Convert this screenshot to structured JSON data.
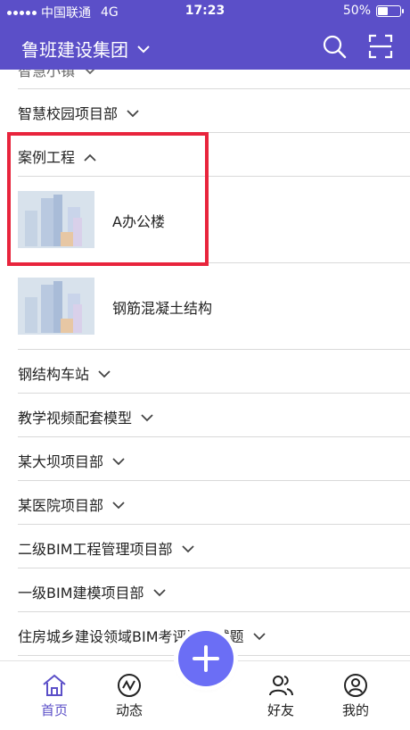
{
  "status_bar": {
    "carrier": "中国联通",
    "network": "4G",
    "time": "17:23",
    "battery": "50%",
    "battery_level": 0.5
  },
  "header": {
    "title": "鲁班建设集团"
  },
  "list": {
    "cut_off_label": "智慧小镇",
    "groups_top": [
      {
        "label": "智慧校园项目部",
        "expanded": false
      },
      {
        "label": "案例工程",
        "expanded": true
      }
    ],
    "items": [
      {
        "label": "A办公楼",
        "thumb": "building-thumbnail"
      },
      {
        "label": "钢筋混凝土结构",
        "thumb": "building-thumbnail"
      }
    ],
    "groups_bottom": [
      {
        "label": "钢结构车站"
      },
      {
        "label": "教学视频配套模型"
      },
      {
        "label": "某大坝项目部"
      },
      {
        "label": "某医院项目部"
      },
      {
        "label": "二级BIM工程管理项目部"
      },
      {
        "label": "一级BIM建模项目部"
      },
      {
        "label": "住房城乡建设领域BIM考评过往试题"
      }
    ]
  },
  "tabbar": {
    "tabs": [
      {
        "label": "首页",
        "icon": "home-icon",
        "active": true
      },
      {
        "label": "动态",
        "icon": "activity-icon",
        "active": false
      },
      {
        "label": "好友",
        "icon": "friends-icon",
        "active": false
      },
      {
        "label": "我的",
        "icon": "profile-icon",
        "active": false
      }
    ],
    "add_icon": "plus-icon"
  },
  "colors": {
    "brand": "#5b4fc8",
    "fab": "#6b6ef5",
    "highlight": "#e8243c"
  }
}
